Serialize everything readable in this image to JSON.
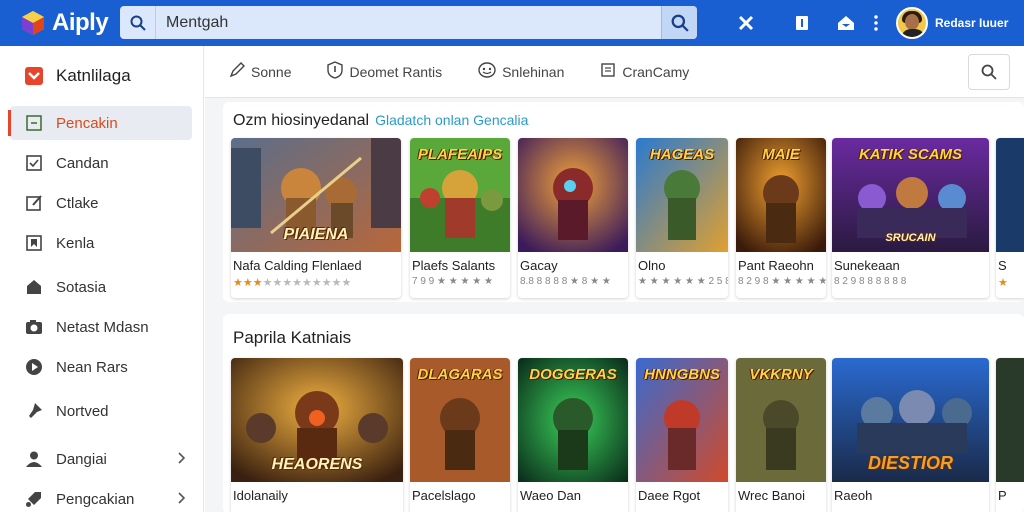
{
  "app": {
    "name": "Aiply"
  },
  "search": {
    "value": "Mentgah"
  },
  "user": {
    "name": "Redasr Iuuer"
  },
  "colors": {
    "topbar": "#1a5fd1",
    "accent": "#e6452b",
    "active_text": "#d74c1e",
    "link": "#2a9bc9",
    "star": "#e88b1c"
  },
  "sidebar": {
    "header": {
      "label": "Katnlilaga",
      "icon": "shield-logo-icon"
    },
    "items": [
      {
        "label": "Pencakin",
        "icon": "square-icon",
        "active": true
      },
      {
        "label": "Candan",
        "icon": "checklist-icon"
      },
      {
        "label": "Ctlake",
        "icon": "edit-icon"
      },
      {
        "label": "Kenla",
        "icon": "bookmark-icon"
      },
      {
        "label": "Sotasia",
        "icon": "home-icon"
      },
      {
        "label": "Netast Mdasn",
        "icon": "camera-icon"
      },
      {
        "label": "Nean Rars",
        "icon": "play-circle-icon"
      },
      {
        "label": "Nortved",
        "icon": "pin-icon"
      },
      {
        "label": "Dangiai",
        "icon": "user-icon",
        "chevron": true
      },
      {
        "label": "Pengcakian",
        "icon": "tag-icon",
        "chevron": true
      }
    ]
  },
  "filters": [
    {
      "label": "Sonne",
      "icon": "pencil-icon"
    },
    {
      "label": "Deomet Rantis",
      "icon": "shield-icon"
    },
    {
      "label": "Snlehinan",
      "icon": "smile-icon"
    },
    {
      "label": "CranCamy",
      "icon": "document-icon"
    }
  ],
  "section1": {
    "title": "Ozm hiosinyedanal",
    "subtitle": "Gladatch onlan Gencalia",
    "cards": [
      {
        "title": "Nafa Calding Flenlaed",
        "thumb_label": "PIAIENA",
        "stars": "★★★",
        "stars_off": "★★★★★★★★★"
      },
      {
        "title": "Plaefs Salants",
        "thumb_top": "PLAFEAIPS",
        "meta": "7 9 9 ★ ★ ★ ★ ★"
      },
      {
        "title": "Gacay",
        "meta": "8.8 8 8 8 8 ★ 8 ★ ★"
      },
      {
        "title": "Olno",
        "thumb_top": "HAGEAS",
        "meta": "★ ★ ★ ★ ★ ★  2 5 8"
      },
      {
        "title": "Pant Raeohn",
        "thumb_top": "MAIE",
        "meta": "8 2 9 8 ★ ★ ★ ★ ★"
      },
      {
        "title": "Sunekeaan",
        "thumb_top": "KATIK SCAMS",
        "thumb_label": "SRUCAIN",
        "meta": "8 2 9 8 8 8 8 8 8"
      },
      {
        "title": "S",
        "meta": "★"
      }
    ]
  },
  "section2": {
    "title": "Paprila Katniais",
    "cards": [
      {
        "title": "Idolanaily",
        "thumb_label": "HEAORENS"
      },
      {
        "title": "Pacelslago",
        "thumb_top": "DLAGARAS"
      },
      {
        "title": "Waeo Dan",
        "thumb_top": "DOGGERAS"
      },
      {
        "title": "Daee Rgot",
        "thumb_top": "HNNGBNS"
      },
      {
        "title": "Wrec Banoi",
        "thumb_top": "VKKRNY"
      },
      {
        "title": "Raeoh",
        "thumb_label": "DIESTIOR"
      },
      {
        "title": "P",
        "thumb_label": ""
      }
    ]
  }
}
